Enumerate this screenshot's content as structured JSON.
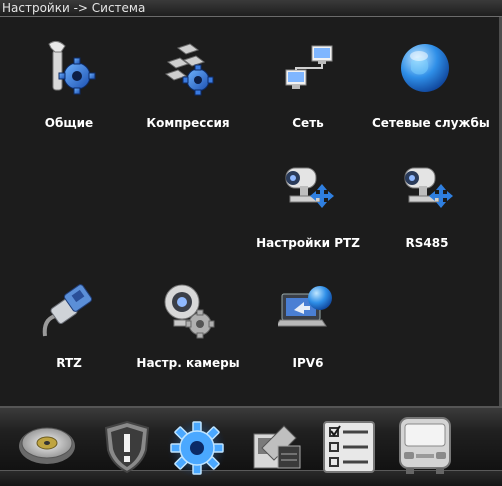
{
  "window": {
    "title": "Настройки -> Система"
  },
  "tiles": [
    {
      "label": "Общие",
      "icon": "wrench-gear-icon"
    },
    {
      "label": "Компрессия",
      "icon": "compression-blocks-icon"
    },
    {
      "label": "Сеть",
      "icon": "network-icon"
    },
    {
      "label": "Сетевые службы",
      "icon": "globe-icon"
    },
    {
      "label": "Настройки PTZ",
      "icon": "ptz-camera-icon"
    },
    {
      "label": "RS485",
      "icon": "rs485-camera-icon"
    },
    {
      "label": "RTZ",
      "icon": "cable-connector-icon"
    },
    {
      "label": "Настр. камеры",
      "icon": "webcam-gear-icon"
    },
    {
      "label": "IPV6",
      "icon": "laptop-globe-icon"
    }
  ],
  "taskbar": [
    {
      "icon": "disk-icon"
    },
    {
      "icon": "alarm-shield-icon"
    },
    {
      "icon": "system-gear-icon",
      "active": true
    },
    {
      "icon": "tools-icon"
    },
    {
      "icon": "checklist-icon"
    },
    {
      "icon": "bus-icon"
    }
  ]
}
